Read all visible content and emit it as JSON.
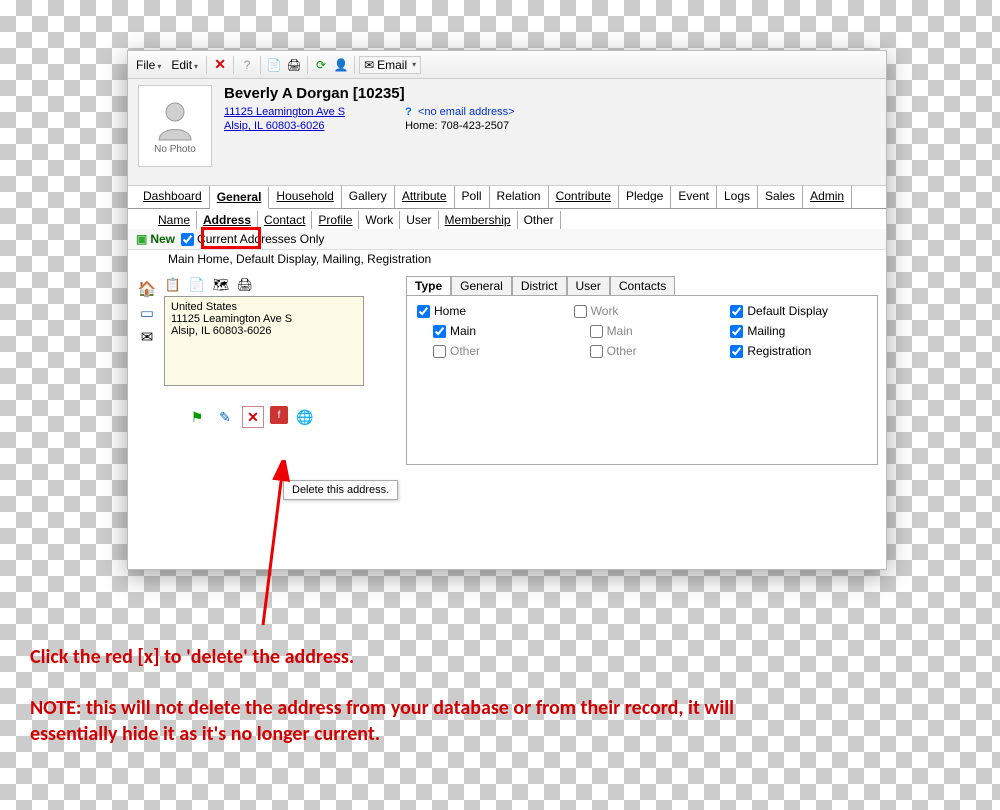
{
  "toolbar": {
    "file": "File",
    "edit": "Edit",
    "email_label": "Email"
  },
  "contact": {
    "name": "Beverly A Dorgan  [10235]",
    "addr_line1": "11125 Leamington Ave S",
    "addr_line2": "Alsip, IL 60803-6026",
    "no_email": "<no email address>",
    "phone": "Home: 708-423-2507",
    "no_photo": "No Photo"
  },
  "tabs": [
    "Dashboard",
    "General",
    "Household",
    "Gallery",
    "Attribute",
    "Poll",
    "Relation",
    "Contribute",
    "Pledge",
    "Event",
    "Logs",
    "Sales",
    "Admin"
  ],
  "active_tab": "General",
  "subtabs": [
    "Name",
    "Address",
    "Contact",
    "Profile",
    "Work",
    "User",
    "Membership",
    "Other"
  ],
  "active_subtab": "Address",
  "newbar": {
    "new": "New",
    "current_only": "Current Addresses Only"
  },
  "addr_summary": "Main Home, Default Display, Mailing, Registration",
  "addr_card": {
    "country": "United States",
    "line1": "11125 Leamington Ave S",
    "line2": "Alsip, IL  60803-6026"
  },
  "tooltip": "Delete this address.",
  "panel_tabs": [
    "Type",
    "General",
    "District",
    "User",
    "Contacts"
  ],
  "active_panel_tab": "Type",
  "type_checks": {
    "home": {
      "label": "Home",
      "checked": true
    },
    "work": {
      "label": "Work",
      "checked": false
    },
    "default_display": {
      "label": "Default Display",
      "checked": true
    },
    "main1": {
      "label": "Main",
      "checked": true
    },
    "main2": {
      "label": "Main",
      "checked": false
    },
    "mailing": {
      "label": "Mailing",
      "checked": true
    },
    "other1": {
      "label": "Other",
      "checked": false
    },
    "other2": {
      "label": "Other",
      "checked": false
    },
    "registration": {
      "label": "Registration",
      "checked": true
    }
  },
  "annotation": {
    "line1": "Click the red [x] to 'delete' the address.",
    "line2": "NOTE: this will not delete the address from your database or from their record, it will essentially hide it as it's no longer current."
  }
}
